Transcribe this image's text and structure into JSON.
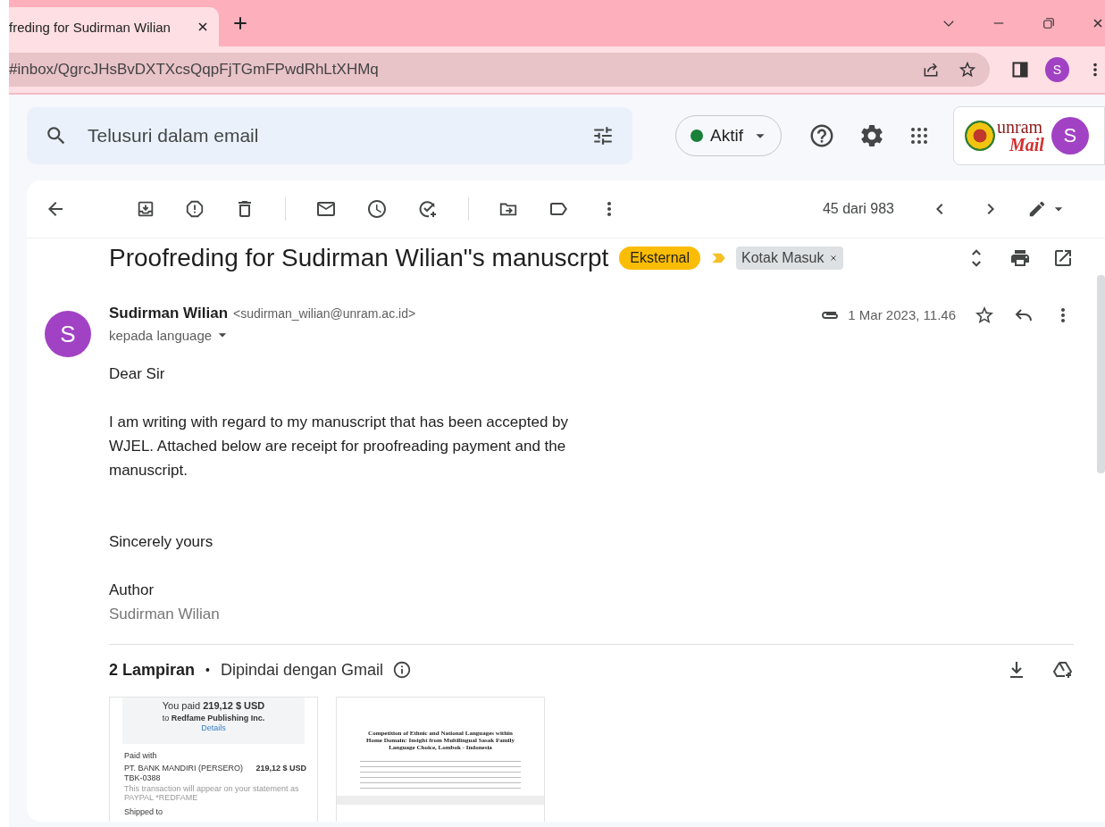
{
  "browser": {
    "tab_title": "freding for Sudirman Wilian",
    "url": "#inbox/QgrcJHsBvDXTXcsQqpFjTGmFPwdRhLtXHMq",
    "profile_initial": "S"
  },
  "header": {
    "search": {
      "placeholder": "Telusuri dalam email"
    },
    "status": "Aktif",
    "logo": {
      "word": "unram",
      "sub": "Mail"
    },
    "avatar_initial": "S"
  },
  "toolbar": {
    "counter": "45 dari 983"
  },
  "message": {
    "subject": "Proofreding for Sudirman Wilian\"s manuscrpt",
    "labels": [
      {
        "text": "Eksternal",
        "kind": "external"
      },
      {
        "text": "Kotak Masuk",
        "kind": "inbox"
      }
    ],
    "sender": {
      "initial": "S",
      "name": "Sudirman Wilian",
      "email": "<sudirman_wilian@unram.ac.id>"
    },
    "recipient": "kepada language",
    "date": "1 Mar 2023, 11.46",
    "starred": false,
    "body": [
      {
        "kind": "greeting",
        "text": "Dear Sir"
      },
      {
        "kind": "paragraph",
        "text": "I am writing with regard to my manuscript that has been accepted by WJEL. Attached below are receipt for proofreading payment and the manuscript."
      },
      {
        "kind": "closing",
        "text": "Sincerely yours"
      },
      {
        "kind": "signoff",
        "text": "Author"
      },
      {
        "kind": "signature",
        "text": "Sudirman Wilian"
      }
    ]
  },
  "attachments": {
    "count": "2 Lampiran",
    "separator": "•",
    "scan_note": "Dipindai dengan Gmail",
    "items": [
      {
        "kind": "receipt",
        "paid": "You paid **219,12 $ USD**",
        "to": "to **Redfame Publishing Inc.**",
        "details": "Details",
        "paid_with": "Paid with",
        "method": "PT. BANK MANDIRI (PERSERO) TBK-0388",
        "amount": "219,12 $ USD",
        "note": "This transaction will appear on your statement as PAYPAL *REDFAME",
        "shipped": "Shipped to"
      },
      {
        "kind": "document",
        "title": "Competition of Ethnic and National Languages within Home Domain: Insight from Multilingual Sasak Family Language Choice, Lombok - Indonesia"
      }
    ]
  }
}
